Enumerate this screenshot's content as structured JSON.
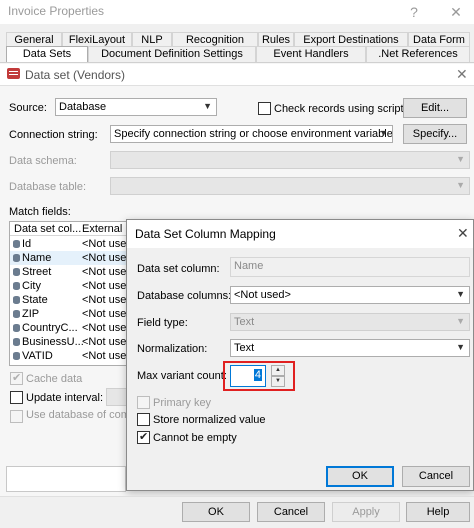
{
  "window": {
    "title": "Invoice Properties",
    "help": "?",
    "close": "✕"
  },
  "tabs_row1": [
    "General",
    "FlexiLayout",
    "NLP",
    "Recognition",
    "Rules",
    "Export Destinations",
    "Data Form"
  ],
  "tabs_row2": [
    "Data Sets",
    "Document Definition Settings",
    "Event Handlers",
    ".Net References"
  ],
  "dataset": {
    "title": "Data set (Vendors)",
    "close": "✕",
    "source_label": "Source:",
    "source_value": "Database",
    "check_records_label": "Check records using scripts",
    "edit_button": "Edit...",
    "connection_label": "Connection string:",
    "connection_value": "Specify connection string or choose environment variable...",
    "specify_button": "Specify...",
    "schema_label": "Data schema:",
    "table_label": "Database table:",
    "match_fields_label": "Match  fields:",
    "grid_headers": [
      "Data set col...",
      "External D"
    ],
    "grid_rows": [
      {
        "name": "Id",
        "ext": "<Not used"
      },
      {
        "name": "Name",
        "ext": "<Not used"
      },
      {
        "name": "Street",
        "ext": "<Not used"
      },
      {
        "name": "City",
        "ext": "<Not used"
      },
      {
        "name": "State",
        "ext": "<Not used"
      },
      {
        "name": "ZIP",
        "ext": "<Not used"
      },
      {
        "name": "CountryC...",
        "ext": "<Not used"
      },
      {
        "name": "BusinessU...",
        "ext": "<Not used"
      },
      {
        "name": "VATID",
        "ext": "<Not used"
      }
    ],
    "cache_data_label": "Cache data",
    "update_interval_label": "Update interval:",
    "use_database_label": "Use database of compar"
  },
  "dialog": {
    "title": "Data Set Column Mapping",
    "close": "✕",
    "column_label": "Data set column:",
    "column_value": "Name",
    "db_columns_label": "Database columns:",
    "db_columns_value": "<Not used>",
    "field_type_label": "Field type:",
    "field_type_value": "Text",
    "normalization_label": "Normalization:",
    "normalization_value": "Text",
    "max_variant_label": "Max variant count:",
    "max_variant_value": "4",
    "primary_key_label": "Primary key",
    "store_normalized_label": "Store normalized value",
    "cannot_be_empty_label": "Cannot be empty",
    "ok_button": "OK",
    "cancel_button": "Cancel"
  },
  "footer": {
    "ok": "OK",
    "cancel": "Cancel",
    "apply": "Apply",
    "help": "Help"
  }
}
